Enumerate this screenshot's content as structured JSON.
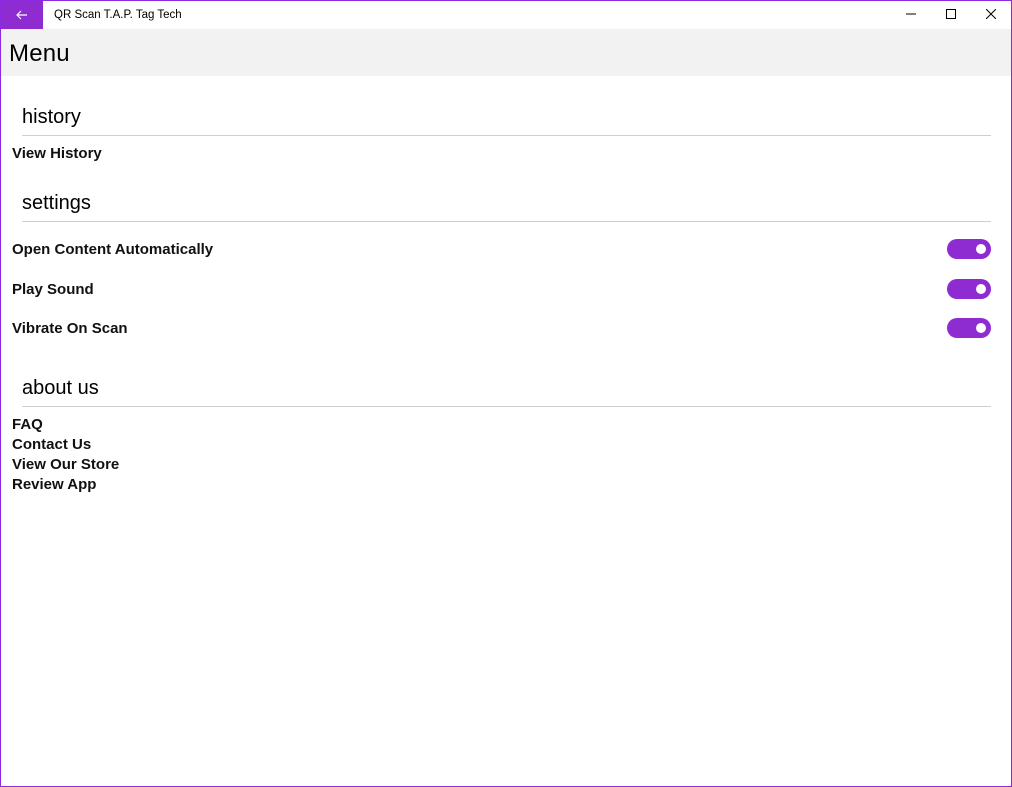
{
  "window": {
    "title": "QR Scan T.A.P. Tag Tech",
    "accent_color": "#8e2bd1"
  },
  "header": {
    "title": "Menu"
  },
  "sections": {
    "history": {
      "title": "history",
      "items": [
        "View History"
      ]
    },
    "settings": {
      "title": "settings",
      "toggles": [
        {
          "label": "Open Content Automatically",
          "on": true
        },
        {
          "label": "Play Sound",
          "on": true
        },
        {
          "label": "Vibrate On Scan",
          "on": true
        }
      ]
    },
    "about": {
      "title": "about us",
      "items": [
        "FAQ",
        "Contact Us",
        "View Our Store",
        "Review App"
      ]
    }
  },
  "icons": {
    "back": "arrow-left-icon",
    "minimize": "minimize-icon",
    "maximize": "maximize-icon",
    "close": "close-icon"
  }
}
